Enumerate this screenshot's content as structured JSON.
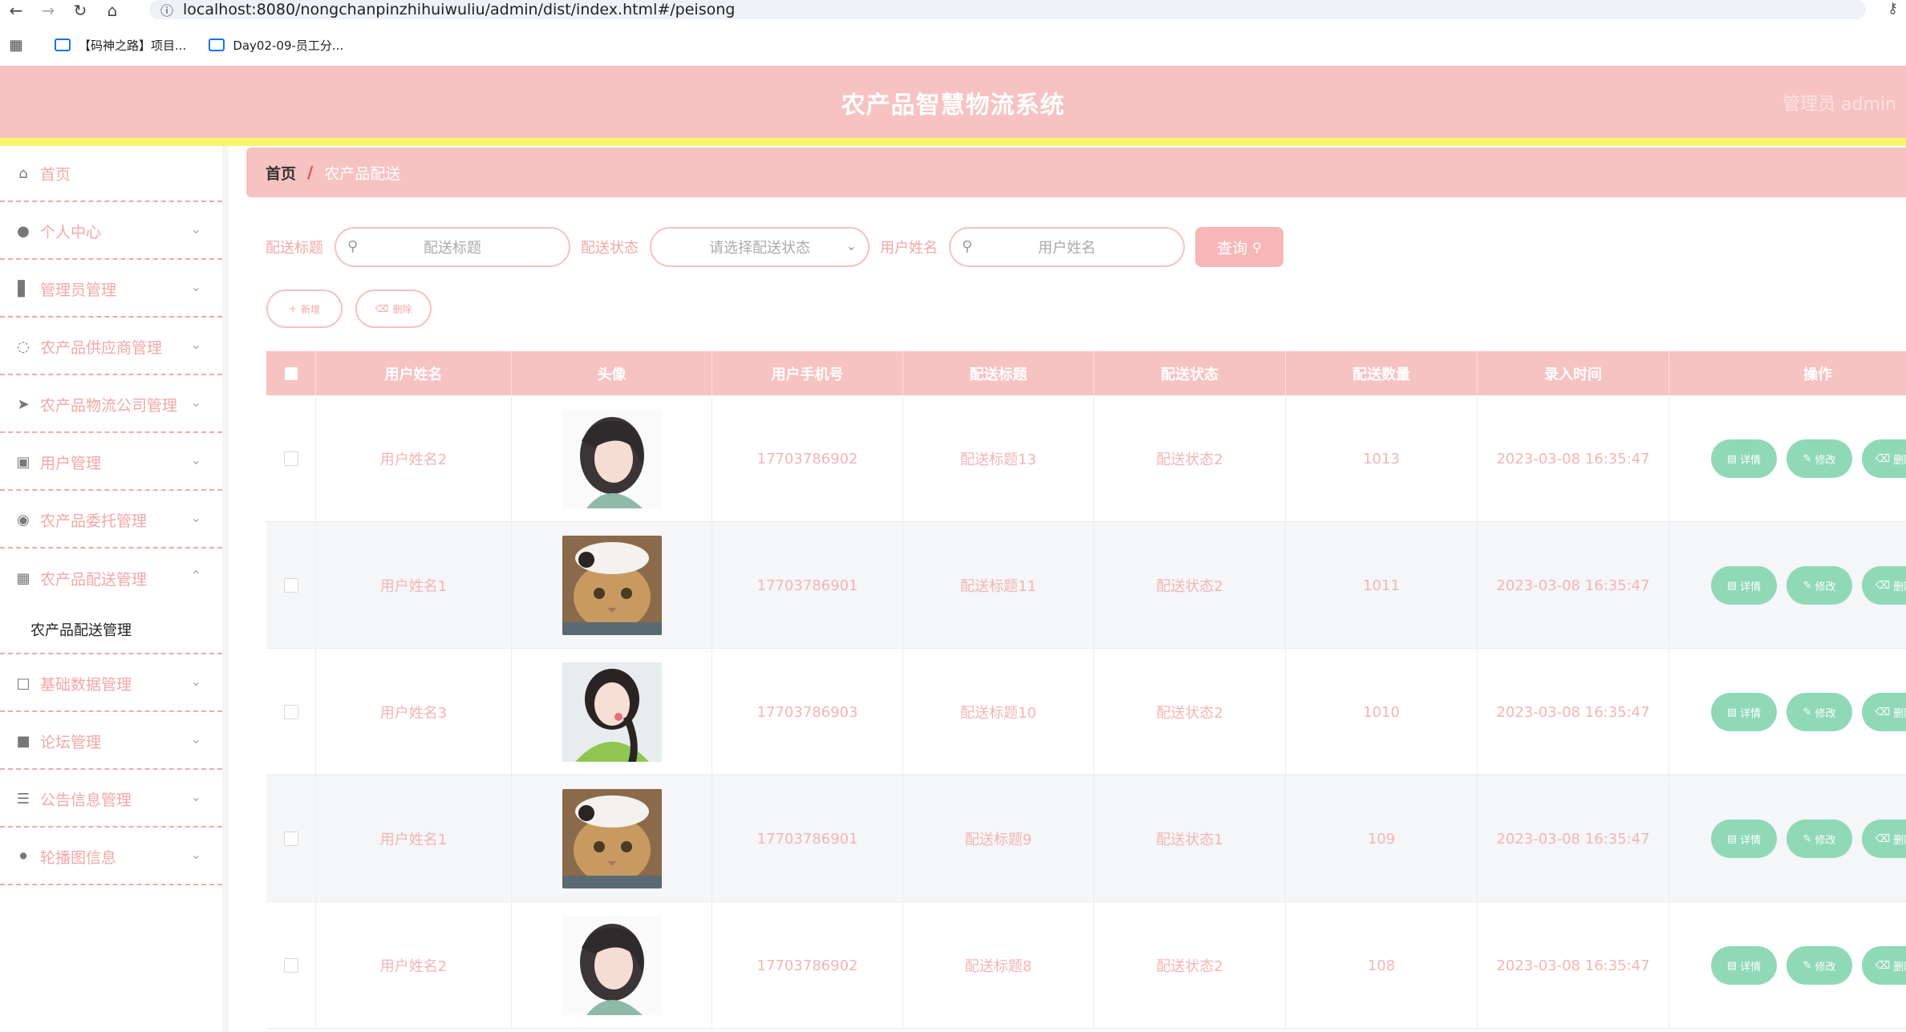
{
  "browser": {
    "url": "localhost:8080/nongchanpinzhihuiwuliu/admin/dist/index.html#/peisong",
    "bookmarks": [
      "【码神之路】项目...",
      "Day02-09-员工分..."
    ]
  },
  "header": {
    "title": "农产品智慧物流系统",
    "admin": "管理员 admin"
  },
  "sidebar": {
    "items": [
      {
        "label": "首页",
        "icon": "home-icon"
      },
      {
        "label": "个人中心",
        "icon": "user-icon"
      },
      {
        "label": "管理员管理",
        "icon": "chart-icon"
      },
      {
        "label": "农产品供应商管理",
        "icon": "gauge-icon"
      },
      {
        "label": "农产品物流公司管理",
        "icon": "send-icon"
      },
      {
        "label": "用户管理",
        "icon": "graph-icon"
      },
      {
        "label": "农产品委托管理",
        "icon": "circle-icon"
      },
      {
        "label": "农产品配送管理",
        "icon": "grid-icon"
      },
      {
        "label": "基础数据管理",
        "icon": "crop-icon"
      },
      {
        "label": "论坛管理",
        "icon": "briefcase-icon"
      },
      {
        "label": "公告信息管理",
        "icon": "sliders-icon"
      },
      {
        "label": "轮播图信息",
        "icon": "bulb-icon"
      }
    ],
    "sub_item": "农产品配送管理"
  },
  "breadcrumb": {
    "home": "首页",
    "separator": "/",
    "current": "农产品配送"
  },
  "search": {
    "title_label": "配送标题",
    "title_placeholder": "配送标题",
    "status_label": "配送状态",
    "status_placeholder": "请选择配送状态",
    "user_label": "用户姓名",
    "user_placeholder": "用户姓名",
    "query_label": "查询"
  },
  "actions": {
    "add_label": "新增",
    "delete_label": "删除"
  },
  "table": {
    "columns": [
      "用户姓名",
      "头像",
      "用户手机号",
      "配送标题",
      "配送状态",
      "配送数量",
      "录入时间",
      "操作"
    ],
    "rows": [
      {
        "user": "用户姓名2",
        "avatar": "girl-anime",
        "phone": "17703786902",
        "title": "配送标题13",
        "status": "配送状态2",
        "qty": "1013",
        "time": "2023-03-08 16:35:47"
      },
      {
        "user": "用户姓名1",
        "avatar": "cat",
        "phone": "17703786901",
        "title": "配送标题11",
        "status": "配送状态2",
        "qty": "1011",
        "time": "2023-03-08 16:35:47"
      },
      {
        "user": "用户姓名3",
        "avatar": "girl-green",
        "phone": "17703786903",
        "title": "配送标题10",
        "status": "配送状态2",
        "qty": "1010",
        "time": "2023-03-08 16:35:47"
      },
      {
        "user": "用户姓名1",
        "avatar": "cat",
        "phone": "17703786901",
        "title": "配送标题9",
        "status": "配送状态1",
        "qty": "109",
        "time": "2023-03-08 16:35:47"
      },
      {
        "user": "用户姓名2",
        "avatar": "girl-anime",
        "phone": "17703786902",
        "title": "配送标题8",
        "status": "配送状态2",
        "qty": "108",
        "time": "2023-03-08 16:35:47"
      }
    ],
    "op_detail": "详情",
    "op_edit": "修改",
    "op_delete": "删除"
  },
  "colors": {
    "primary_pink": "#f7c2c2",
    "accent_yellow": "#f7f56a",
    "text_pink": "#f3a7a7",
    "op_green": "#8fd9b6"
  }
}
